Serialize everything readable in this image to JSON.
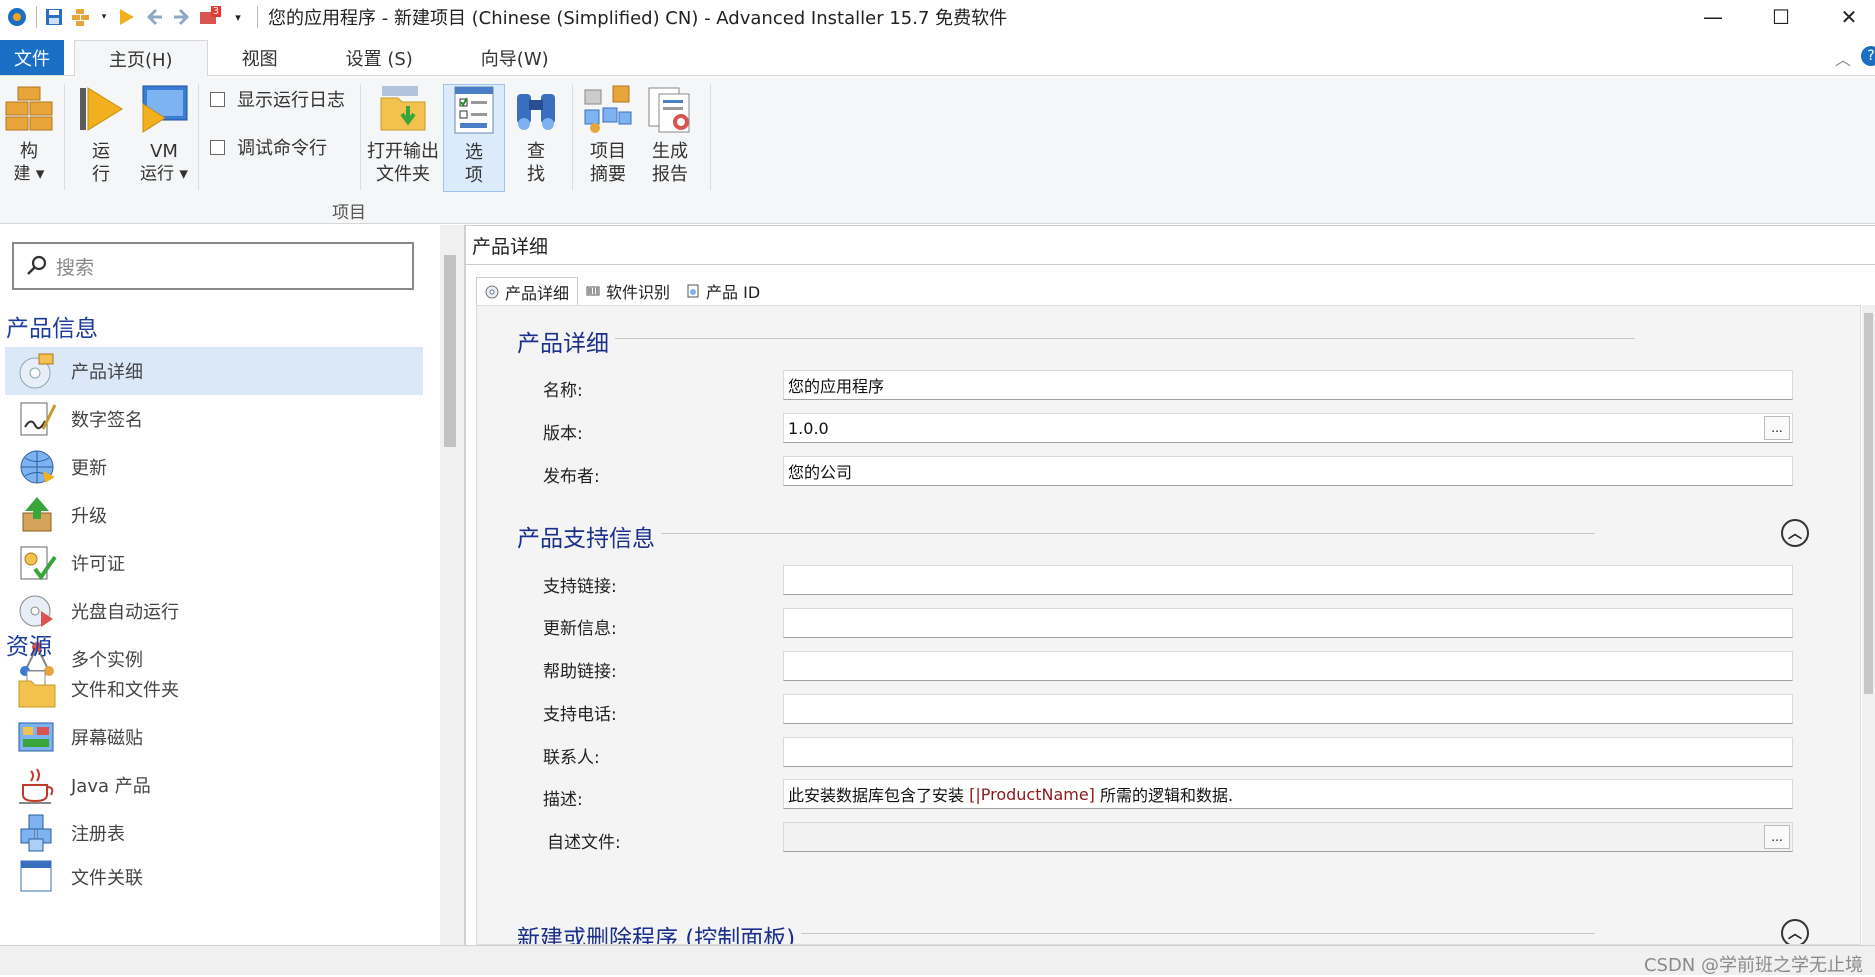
{
  "window": {
    "title": "您的应用程序 - 新建项目 (Chinese (Simplified) CN) - Advanced Installer 15.7 免费软件",
    "badge": "3",
    "minimize": "—",
    "maximize": "☐",
    "close": "✕"
  },
  "tabs": {
    "file": "文件",
    "home": "主页(H)",
    "view": "视图",
    "settings": "设置 (S)",
    "wizard": "向导(W)"
  },
  "ribbon": {
    "build": [
      "构",
      "建 ▾"
    ],
    "run": [
      "运",
      "行"
    ],
    "vm_run": [
      "VM",
      "运行 ▾"
    ],
    "show_log": "显示运行日志",
    "debug_cmd": "调试命令行",
    "open_output": [
      "打开输出",
      "文件夹"
    ],
    "options": [
      "选",
      "项"
    ],
    "find": [
      "查",
      "找"
    ],
    "summary": [
      "项目",
      "摘要"
    ],
    "report": [
      "生成",
      "报告"
    ],
    "group_label": "项目"
  },
  "sidebar": {
    "search_placeholder": "搜索",
    "cat_product": "产品信息",
    "cat_resources": "资源",
    "items": [
      {
        "label": "产品详细",
        "icon": "product-details-icon"
      },
      {
        "label": "数字签名",
        "icon": "digital-signature-icon"
      },
      {
        "label": "更新",
        "icon": "updates-globe-icon"
      },
      {
        "label": "升级",
        "icon": "upgrade-box-icon"
      },
      {
        "label": "许可证",
        "icon": "license-key-icon"
      },
      {
        "label": "光盘自动运行",
        "icon": "cd-autorun-icon"
      },
      {
        "label": "多个实例",
        "icon": "multiple-instances-icon"
      },
      {
        "label": "文件和文件夹",
        "icon": "files-folders-icon"
      },
      {
        "label": "屏幕磁贴",
        "icon": "screen-tiles-icon"
      },
      {
        "label": "Java 产品",
        "icon": "java-cup-icon"
      },
      {
        "label": "注册表",
        "icon": "registry-cubes-icon"
      },
      {
        "label": "文件关联",
        "icon": "file-association-icon"
      }
    ]
  },
  "main": {
    "header": "产品详细",
    "subtabs": [
      "产品详细",
      "软件识别",
      "产品 ID"
    ],
    "sections": {
      "details_title": "产品详细",
      "support_title": "产品支持信息",
      "control_panel_title": "新建或删除程序 (控制面板)"
    },
    "details": [
      {
        "label": "名称:",
        "value": "您的应用程序"
      },
      {
        "label": "版本:",
        "value": "1.0.0"
      },
      {
        "label": "发布者:",
        "value": "您的公司"
      }
    ],
    "support": [
      {
        "label": "支持链接:",
        "value": ""
      },
      {
        "label": "更新信息:",
        "value": ""
      },
      {
        "label": "帮助链接:",
        "value": ""
      },
      {
        "label": "支持电话:",
        "value": ""
      },
      {
        "label": "联系人:",
        "value": ""
      },
      {
        "label": "描述:",
        "value_before": "此安装数据库包含了安装 ",
        "value_prop": "[|ProductName]",
        "value_after": " 所需的逻辑和数据."
      },
      {
        "label": "自述文件:",
        "value": ""
      }
    ],
    "dots": "..."
  },
  "watermark": "CSDN @学前班之学无止境",
  "colors": {
    "accent": "#1a6fc4",
    "section_title": "#1b2f8c",
    "category": "#1b3c9c",
    "property": "#8b1a1a",
    "selection": "#dbe8f8"
  }
}
